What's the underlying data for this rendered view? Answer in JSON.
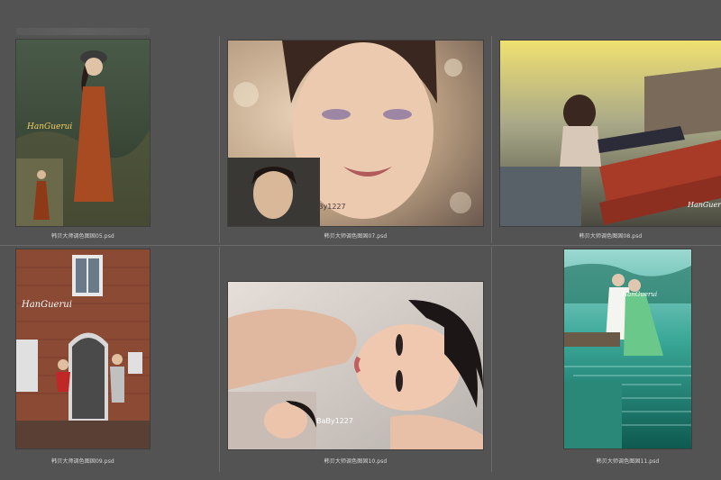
{
  "files": [
    {
      "caption": "韩贝大师调色图固05.psd",
      "icon": "photo-girl-field-icon",
      "overlay": "HanGuerui"
    },
    {
      "caption": "韩贝大师调色图固07.psd",
      "icon": "photo-portrait-closeup-icon",
      "overlay": "By1227"
    },
    {
      "caption": "韩贝大师调色图固08.psd",
      "icon": "photo-girl-bench-icon",
      "overlay": "HanGuerui"
    },
    {
      "caption": "韩贝大师调色图固09.psd",
      "icon": "photo-couple-brickwall-icon",
      "overlay": "HanGuerui"
    },
    {
      "caption": "韩贝大师调色图固10.psd",
      "icon": "photo-lying-portrait-icon",
      "overlay": "BaBy1227"
    },
    {
      "caption": "韩贝大师调色图固11.psd",
      "icon": "photo-couple-lake-icon",
      "overlay": "HanGuerui"
    }
  ],
  "colors": {
    "background": "#535353",
    "divider": "#6a6a6a",
    "caption": "#d8d8d8"
  }
}
